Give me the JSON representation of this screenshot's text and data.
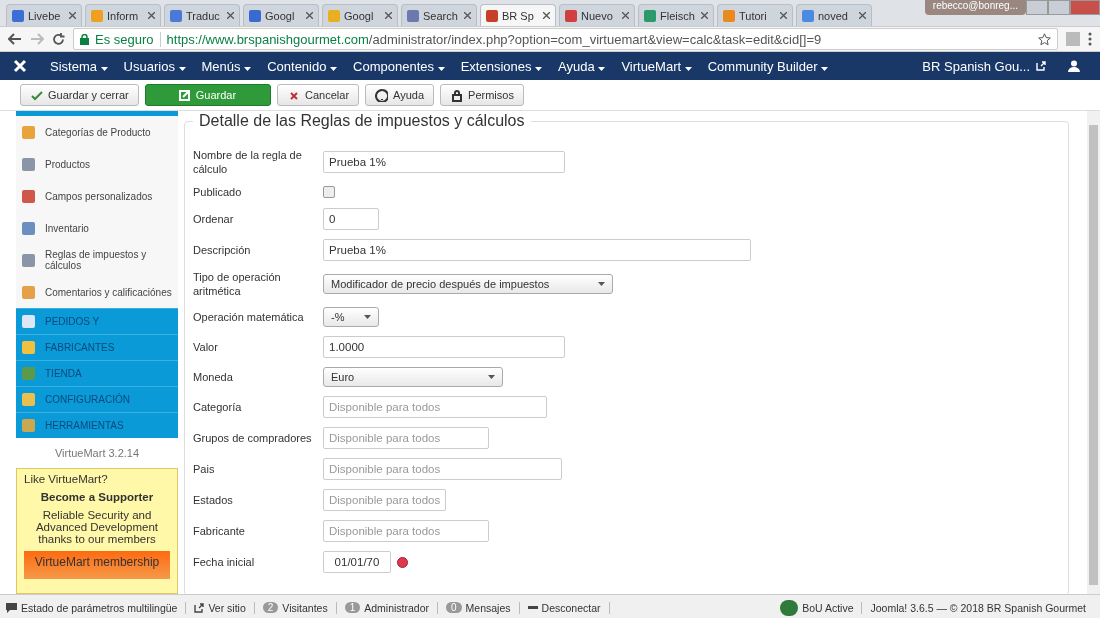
{
  "browser": {
    "tabs": [
      {
        "label": "Livebe",
        "selected": false
      },
      {
        "label": "Inform",
        "selected": false
      },
      {
        "label": "Traduc",
        "selected": false
      },
      {
        "label": "Googl",
        "selected": false
      },
      {
        "label": "Googl",
        "selected": false
      },
      {
        "label": "Search",
        "selected": false
      },
      {
        "label": "BR Sp",
        "selected": true
      },
      {
        "label": "Nuevo",
        "selected": false
      },
      {
        "label": "Fleisch",
        "selected": false
      },
      {
        "label": "Tutori",
        "selected": false
      },
      {
        "label": "noved",
        "selected": false
      }
    ],
    "user": "rebecco@bonreg...",
    "secure_label": "Es seguro",
    "url_host": "https://www.brspanishgourmet.com",
    "url_path": "/administrator/index.php?option=com_virtuemart&view=calc&task=edit&cid[]=9"
  },
  "navbar": {
    "menus": [
      {
        "label": "Sistema"
      },
      {
        "label": "Usuarios"
      },
      {
        "label": "Menús"
      },
      {
        "label": "Contenido"
      },
      {
        "label": "Componentes"
      },
      {
        "label": "Extensiones"
      },
      {
        "label": "Ayuda"
      },
      {
        "label": "VirtueMart"
      },
      {
        "label": "Community Builder"
      }
    ],
    "site": "BR Spanish Gou..."
  },
  "toolbar": [
    {
      "label": "Guardar y cerrar",
      "kind": "check",
      "primary": false
    },
    {
      "label": "Guardar",
      "kind": "edit",
      "primary": true
    },
    {
      "label": "Cancelar",
      "kind": "cancel",
      "primary": false
    },
    {
      "label": "Ayuda",
      "kind": "help",
      "primary": false
    },
    {
      "label": "Permisos",
      "kind": "lock",
      "primary": false
    }
  ],
  "sidebar": {
    "items": [
      {
        "label": "Categorías de Producto",
        "kind": "item"
      },
      {
        "label": "Productos",
        "kind": "item"
      },
      {
        "label": "Campos personalizados",
        "kind": "item"
      },
      {
        "label": "Inventario",
        "kind": "item"
      },
      {
        "label": "Reglas de impuestos y cálculos",
        "kind": "item"
      },
      {
        "label": "Comentarios y calificaciónes",
        "kind": "item"
      },
      {
        "label": "PEDIDOS Y",
        "kind": "section"
      },
      {
        "label": "FABRICANTES",
        "kind": "section"
      },
      {
        "label": "TIENDA",
        "kind": "section"
      },
      {
        "label": "CONFIGURACIÓN",
        "kind": "section"
      },
      {
        "label": "HERRAMIENTAS",
        "kind": "section"
      }
    ],
    "version": "VirtueMart 3.2.14",
    "promo": {
      "question": "Like VirtueMart?",
      "heading": "Become a Supporter",
      "text": "Reliable Security and Advanced Development thanks to our members",
      "button": "VirtueMart membership"
    }
  },
  "form": {
    "title": "Detalle de las Reglas de impuestos y cálculos",
    "fields": [
      {
        "label": "Nombre de la regla de cálculo",
        "kind": "text",
        "value": "Prueba 1%"
      },
      {
        "label": "Publicado",
        "kind": "checkbox",
        "checked": false
      },
      {
        "label": "Ordenar",
        "kind": "text",
        "value": "0"
      },
      {
        "label": "Descripción",
        "kind": "text",
        "value": "Prueba 1%"
      },
      {
        "label": "Tipo de operación aritmética",
        "kind": "select",
        "value": "Modificador de precio después de impuestos"
      },
      {
        "label": "Operación matemática",
        "kind": "select",
        "value": "-%"
      },
      {
        "label": "Valor",
        "kind": "text",
        "value": "1.0000"
      },
      {
        "label": "Moneda",
        "kind": "select",
        "value": "Euro"
      },
      {
        "label": "Categoría",
        "kind": "text",
        "placeholder": "Disponible para todos"
      },
      {
        "label": "Grupos de compradores",
        "kind": "text",
        "placeholder": "Disponible para todos"
      },
      {
        "label": "Pais",
        "kind": "text",
        "placeholder": "Disponible para todos"
      },
      {
        "label": "Estados",
        "kind": "text",
        "placeholder": "Disponible para todos"
      },
      {
        "label": "Fabricante",
        "kind": "text",
        "placeholder": "Disponible para todos"
      },
      {
        "label": "Fecha inicial",
        "kind": "date",
        "value": "01/01/70"
      }
    ]
  },
  "status_bar": {
    "left": [
      {
        "label": "Estado de parámetros multilingüe",
        "kind": "comment"
      },
      {
        "label": "Ver sitio",
        "kind": "external"
      },
      {
        "label": "Visitantes",
        "kind": "count",
        "count": "2"
      },
      {
        "label": "Administrador",
        "kind": "count",
        "count": "1"
      },
      {
        "label": "Mensajes",
        "kind": "count",
        "count": "0"
      },
      {
        "label": "Desconectar",
        "kind": "minus"
      }
    ],
    "badge": "BoU Active",
    "copyright": "Joomla! 3.6.5 — © 2018 BR Spanish Gourmet"
  }
}
